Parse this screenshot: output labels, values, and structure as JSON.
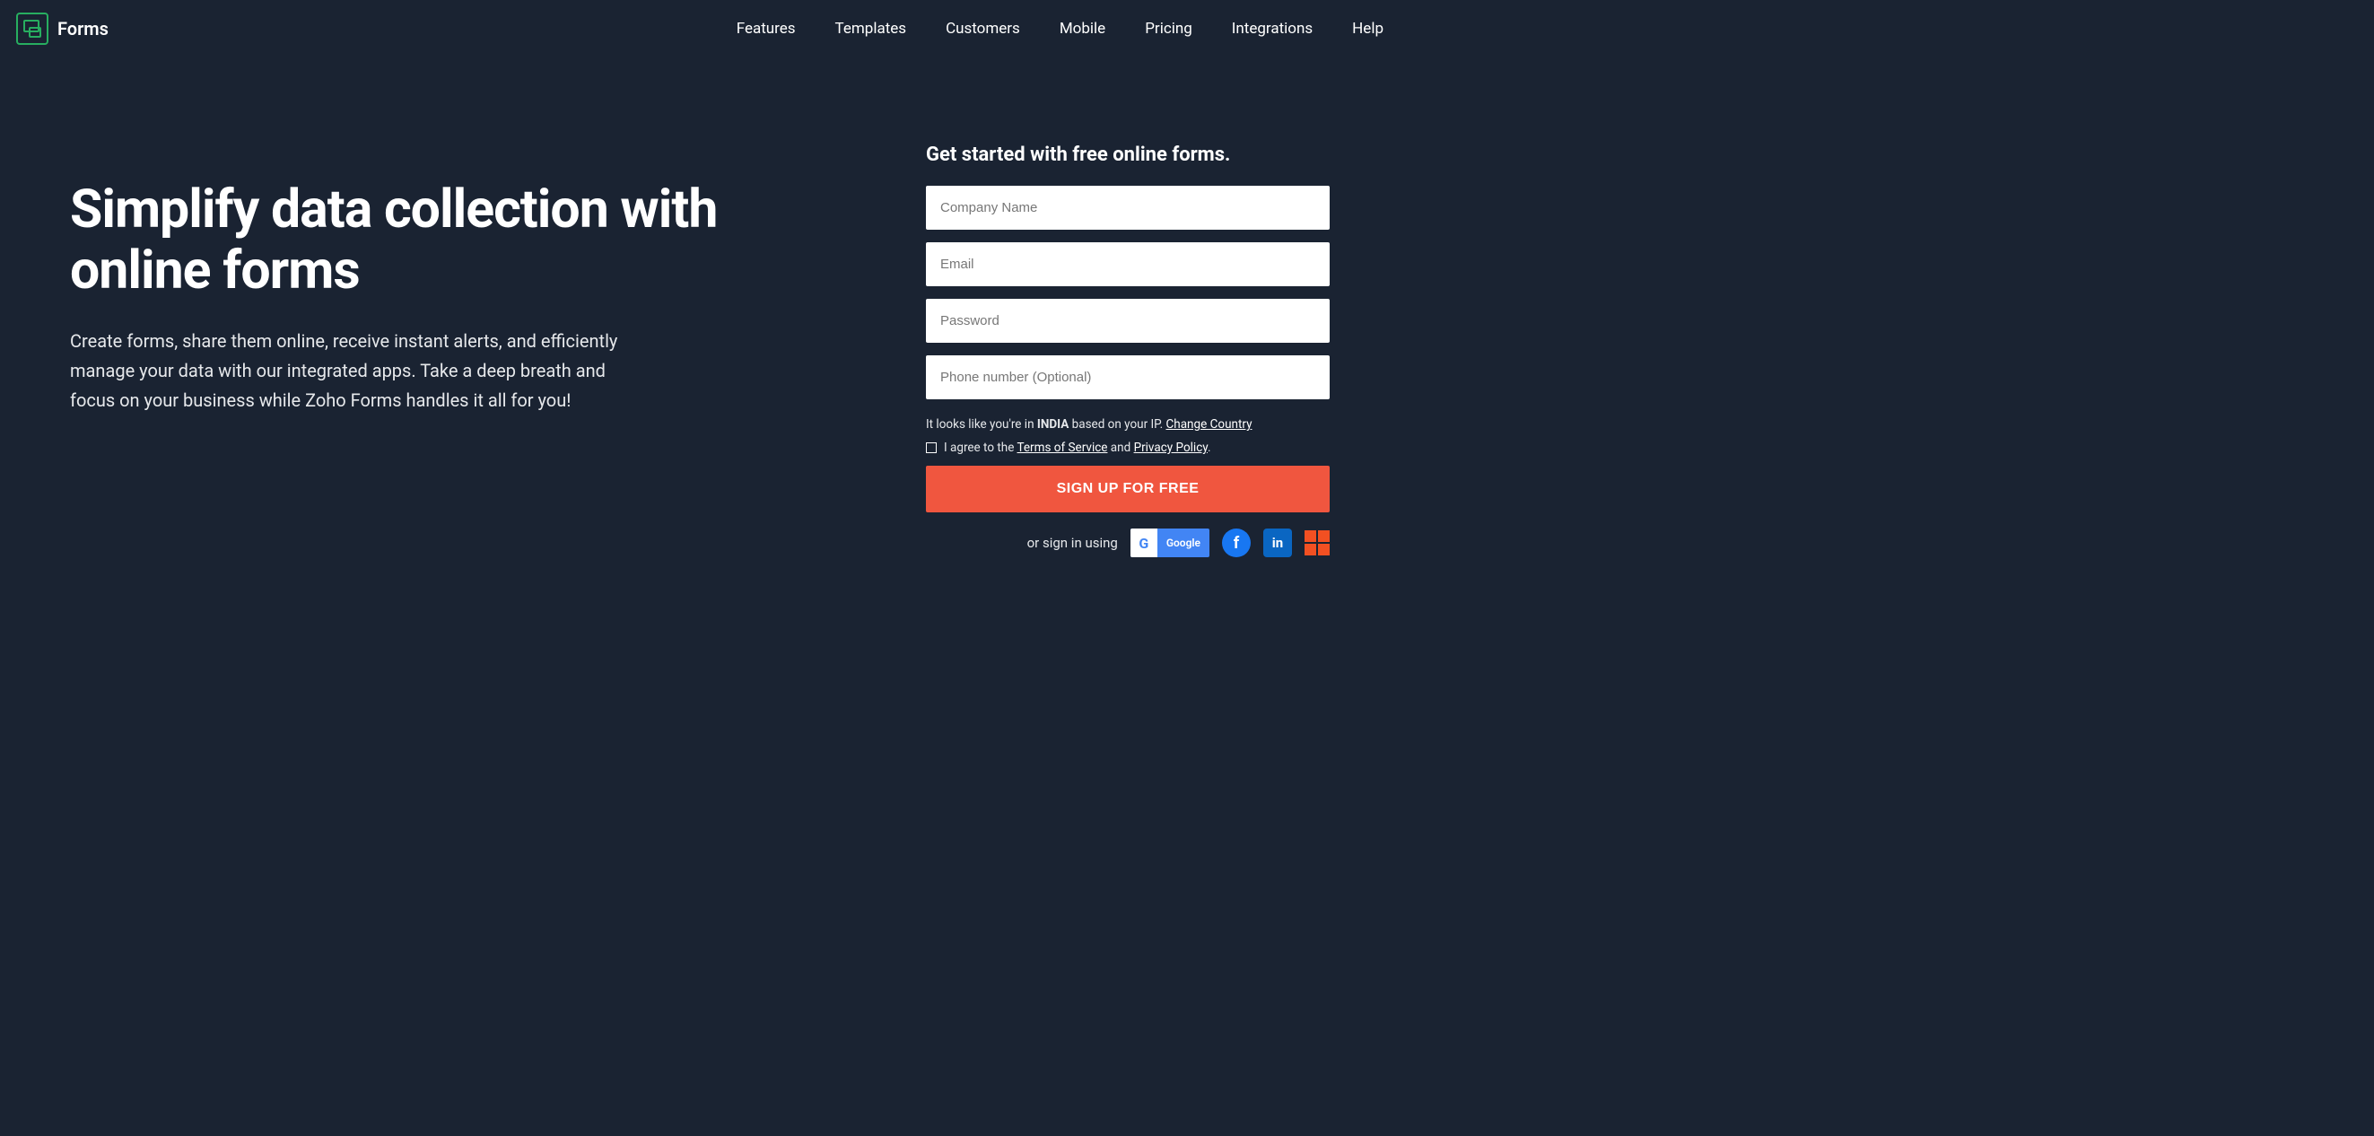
{
  "header": {
    "brand": "Forms",
    "nav": [
      "Features",
      "Templates",
      "Customers",
      "Mobile",
      "Pricing",
      "Integrations",
      "Help"
    ]
  },
  "hero": {
    "title": "Simplify data collection with online forms",
    "subtitle": "Create forms, share them online, receive instant alerts, and efficiently manage your data with our integrated apps. Take a deep breath and focus on your business while Zoho Forms handles it all for you!"
  },
  "form": {
    "heading": "Get started with free online forms.",
    "placeholders": {
      "company": "Company Name",
      "email": "Email",
      "password": "Password",
      "phone": "Phone number (Optional)"
    },
    "location_prefix": "It looks like you're in ",
    "location_country": "INDIA",
    "location_suffix": " based on your IP. ",
    "change_country": "Change Country",
    "agree_prefix": "I agree to the ",
    "tos": "Terms of Service",
    "agree_mid": " and ",
    "privacy": "Privacy Policy",
    "agree_suffix": ".",
    "signup_button": "SIGN UP FOR FREE",
    "social_label": "or sign in using",
    "google_label": "Google"
  }
}
